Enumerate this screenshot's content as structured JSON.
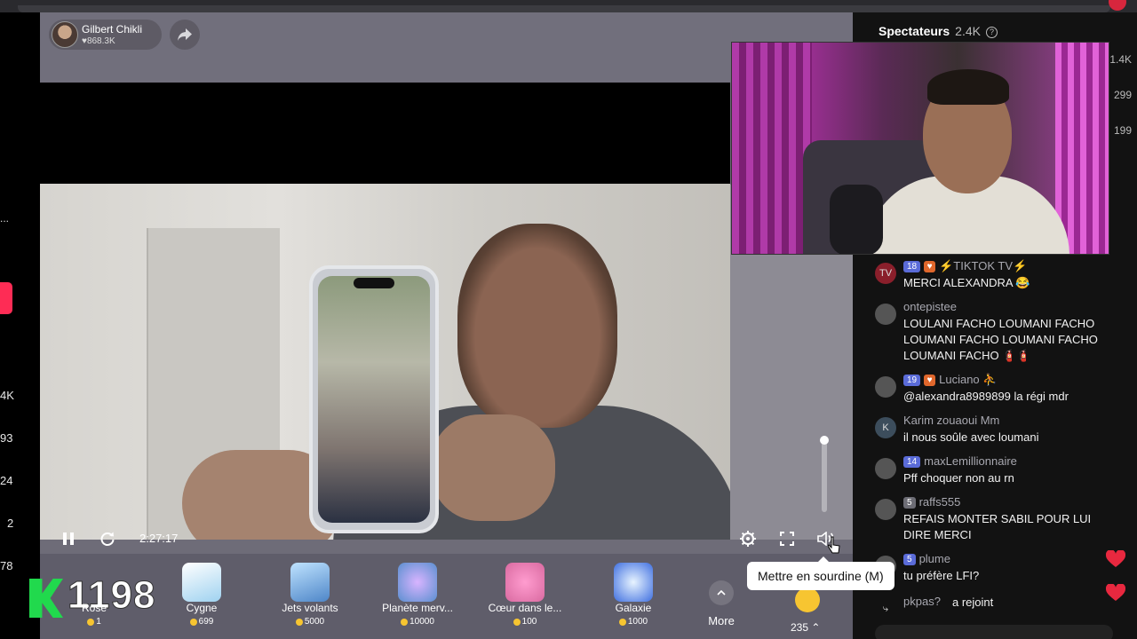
{
  "host": {
    "name": "Gilbert Chikli",
    "likes": "♥868.3K"
  },
  "left_edge_numbers": [
    "4K",
    "93",
    "24",
    "2",
    "78"
  ],
  "left_edge_more": "...",
  "video": {
    "time": "2:27:17"
  },
  "gifts": {
    "combo_count": "1198",
    "items": [
      {
        "name": "Rose",
        "price": "1",
        "color": "#e23b55"
      },
      {
        "name": "Cygne",
        "price": "699",
        "color": "#cfe8f8"
      },
      {
        "name": "Jets volants",
        "price": "5000",
        "color": "#6aa8d8"
      },
      {
        "name": "Planète merv...",
        "price": "10000",
        "color": "#7fb8e8"
      },
      {
        "name": "Cœur dans le...",
        "price": "100",
        "color": "#f08cc0"
      },
      {
        "name": "Galaxie",
        "price": "1000",
        "color": "#5b8cf2"
      }
    ],
    "more_label": "More",
    "coins_label": "235 ⌃"
  },
  "tooltip": "Mettre en sourdine (M)",
  "side": {
    "title": "Spectateurs",
    "viewers": "2.4K",
    "help": "?",
    "right_numbers": [
      "1.4K",
      "299",
      "199"
    ]
  },
  "chat": [
    {
      "user": "⚡TIKTOK TV⚡",
      "level": "18",
      "sub": true,
      "text": "MERCI ALEXANDRA 😂",
      "avatar": "TV"
    },
    {
      "user": "ontepistee",
      "text": "LOULANI FACHO LOUMANI FACHO LOUMANI FACHO LOUMANI FACHO LOUMANI FACHO 🧯🧯",
      "avatar": ""
    },
    {
      "user": "Luciano ⛹",
      "level": "19",
      "sub": true,
      "text": "@alexandra8989899 la régi mdr",
      "avatar": ""
    },
    {
      "user": "Karim zouaoui Mm",
      "text": "il nous soûle avec loumani",
      "avatar": "K"
    },
    {
      "user": "maxLemillionnaire",
      "level": "14",
      "text": "Pff choquer non au rn",
      "avatar": ""
    },
    {
      "user": "raffs555",
      "grey": "5",
      "text": "REFAIS MONTER SABIL POUR LUI DIRE MERCI",
      "avatar": ""
    },
    {
      "user": "plume",
      "level": "5",
      "text": "tu préfère LFI?",
      "avatar": ""
    },
    {
      "user": "pkpas?",
      "text": "a rejoint",
      "avatar": "⤷"
    }
  ],
  "colors": {
    "accent": "#fe2c55",
    "combo_k": "#21d94d",
    "coin": "#f7c531"
  }
}
